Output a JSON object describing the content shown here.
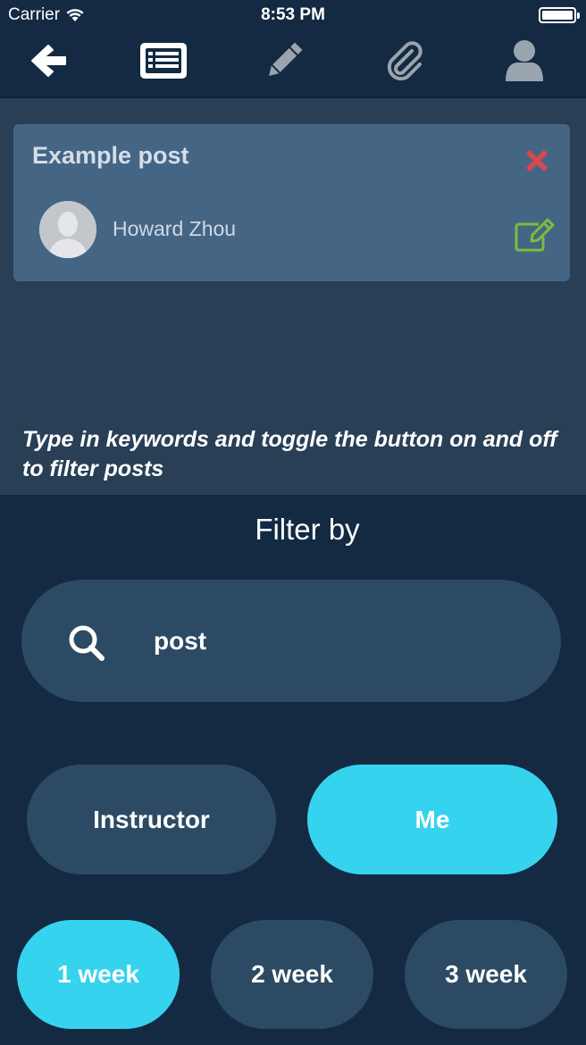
{
  "status_bar": {
    "carrier": "Carrier",
    "time": "8:53 PM"
  },
  "toolbar": {
    "icons": [
      "back-arrow-icon",
      "list-icon",
      "pencil-icon",
      "paperclip-icon",
      "profile-icon"
    ]
  },
  "post": {
    "title": "Example post",
    "author": "Howard Zhou"
  },
  "hint": "Type in keywords and toggle the button on and off to filter posts",
  "filter": {
    "title": "Filter by",
    "search_value": "post",
    "role_buttons": [
      {
        "label": "Instructor",
        "active": false
      },
      {
        "label": "Me",
        "active": true
      }
    ],
    "week_buttons": [
      {
        "label": "1 week",
        "active": true
      },
      {
        "label": "2 week",
        "active": false
      },
      {
        "label": "3 week",
        "active": false
      }
    ]
  },
  "colors": {
    "background": "#132a42",
    "content_panel": "#283f55",
    "card": "#456585",
    "button_inactive": "#2c4a63",
    "button_active": "#36d3ef",
    "delete_red": "#d9484d",
    "edit_green": "#7bbd3d"
  }
}
